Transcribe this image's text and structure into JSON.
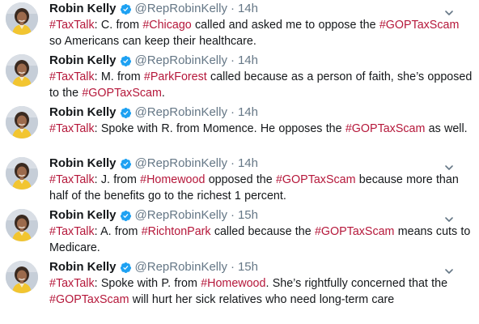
{
  "colors": {
    "hashtag": "#b5173a",
    "meta": "#657786",
    "verified": "#1da1f2"
  },
  "icons": {
    "verified": "verified-badge-icon",
    "menu": "chevron-down-icon"
  },
  "tweets": [
    {
      "name": "Robin Kelly",
      "handle": "@RepRobinKelly",
      "dot": "·",
      "time": "14h",
      "parts": [
        {
          "t": "#TaxTalk",
          "h": true
        },
        {
          "t": ": C. from ",
          "h": false
        },
        {
          "t": "#Chicago",
          "h": true
        },
        {
          "t": " called and asked me to oppose the ",
          "h": false
        },
        {
          "t": "#GOPTaxScam",
          "h": true
        },
        {
          "t": " so Americans can keep their healthcare.",
          "h": false
        }
      ]
    },
    {
      "name": "Robin Kelly",
      "handle": "@RepRobinKelly",
      "dot": "·",
      "time": "14h",
      "parts": [
        {
          "t": "#TaxTalk",
          "h": true
        },
        {
          "t": ": M. from ",
          "h": false
        },
        {
          "t": "#ParkForest",
          "h": true
        },
        {
          "t": " called because as a person of faith, she’s opposed to the ",
          "h": false
        },
        {
          "t": "#GOPTaxScam",
          "h": true
        },
        {
          "t": ".",
          "h": false
        }
      ]
    },
    {
      "name": "Robin Kelly",
      "handle": "@RepRobinKelly",
      "dot": "·",
      "time": "14h",
      "parts": [
        {
          "t": "#TaxTalk",
          "h": true
        },
        {
          "t": ": Spoke with R. from Momence. He opposes the ",
          "h": false
        },
        {
          "t": "#GOPTaxScam",
          "h": true
        },
        {
          "t": " as well.",
          "h": false
        }
      ]
    },
    {
      "name": "Robin Kelly",
      "handle": "@RepRobinKelly",
      "dot": "·",
      "time": "14h",
      "parts": [
        {
          "t": "#TaxTalk",
          "h": true
        },
        {
          "t": ": J. from ",
          "h": false
        },
        {
          "t": "#Homewood",
          "h": true
        },
        {
          "t": " opposed the ",
          "h": false
        },
        {
          "t": "#GOPTaxScam",
          "h": true
        },
        {
          "t": " because more than half of the benefits go to the richest 1 percent.",
          "h": false
        }
      ]
    },
    {
      "name": "Robin Kelly",
      "handle": "@RepRobinKelly",
      "dot": "·",
      "time": "15h",
      "parts": [
        {
          "t": "#TaxTalk",
          "h": true
        },
        {
          "t": ": A. from ",
          "h": false
        },
        {
          "t": "#RichtonPark",
          "h": true
        },
        {
          "t": " called because the ",
          "h": false
        },
        {
          "t": "#GOPTaxScam",
          "h": true
        },
        {
          "t": " means cuts to Medicare.",
          "h": false
        }
      ]
    },
    {
      "name": "Robin Kelly",
      "handle": "@RepRobinKelly",
      "dot": "·",
      "time": "15h",
      "parts": [
        {
          "t": "#TaxTalk",
          "h": true
        },
        {
          "t": ": Spoke with P. from ",
          "h": false
        },
        {
          "t": "#Homewood",
          "h": true
        },
        {
          "t": ". She’s rightfully concerned that the ",
          "h": false
        },
        {
          "t": "#GOPTaxScam",
          "h": true
        },
        {
          "t": " will hurt her sick relatives who need long-term care",
          "h": false
        }
      ]
    }
  ]
}
